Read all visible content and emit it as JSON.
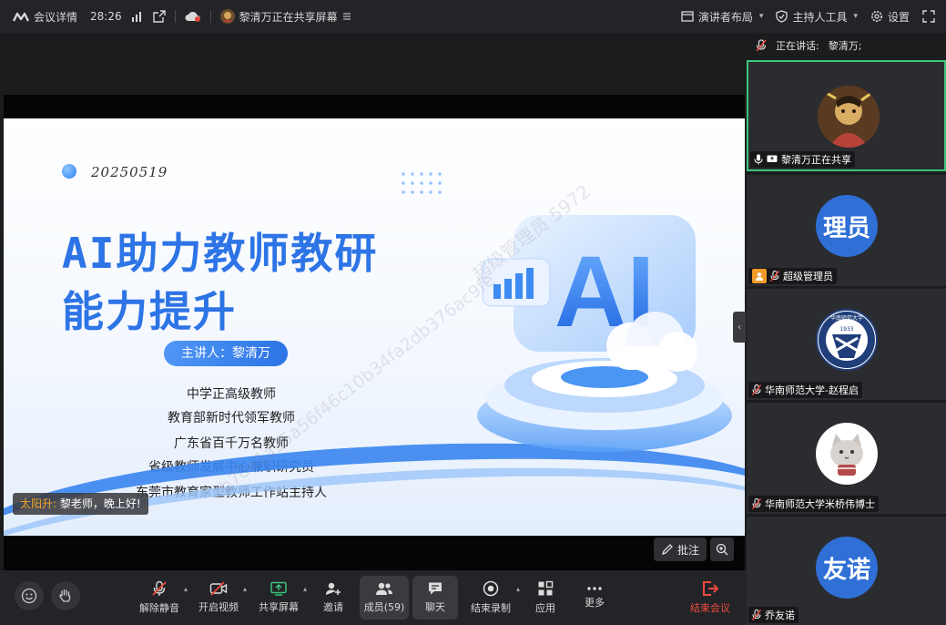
{
  "topbar": {
    "meeting_info": "会议详情",
    "duration": "28:26",
    "sharing_status": "黎清万正在共享屏幕",
    "layout_label": "演讲者布局",
    "host_tools_label": "主持人工具",
    "settings_label": "设置"
  },
  "slide": {
    "date": "20250519",
    "title_line1": "AI助力教师教研",
    "title_line2": "能力提升",
    "presenter": "主讲人：黎清万",
    "credentials": [
      "中学正高级教师",
      "教育部新时代领军教师",
      "广东省百千万名教师",
      "省级教师发展中心兼职研究员",
      "东莞市教育家型教师工作站主持人"
    ],
    "art_text": "AI",
    "watermark_1": "超级管理员 5972",
    "watermark_2": "b70e1a95a56f46c10b34fa2db376ac9fe",
    "watermark_3": "2db376ac9fe",
    "watermark_4": "b70e1a95a56f4",
    "watermark_5": "5972"
  },
  "chat_toast": {
    "sender": "太阳升:",
    "message": "黎老师，晚上好!"
  },
  "stage_controls": {
    "annotate_label": "批注"
  },
  "toolbar": {
    "unmute": "解除静音",
    "start_video": "开启视频",
    "share_screen": "共享屏幕",
    "invite": "邀请",
    "members": "成员(59)",
    "chat": "聊天",
    "end_recording": "结束录制",
    "apps": "应用",
    "more": "更多",
    "end_meeting": "结束会议"
  },
  "panel": {
    "speaking_label": "正在讲话:",
    "speaking_name": "黎清万;",
    "participants": [
      {
        "name": "黎清万正在共享",
        "type": "photo"
      },
      {
        "name": "超级管理员",
        "type": "text",
        "avatar_text": "理员"
      },
      {
        "name": "华南师范大学-赵程启",
        "type": "logo",
        "logo_text": "华南师范大学",
        "logo_year": "1933"
      },
      {
        "name": "华南师范大学米桥伟博士",
        "type": "cat"
      },
      {
        "name": "乔友诺",
        "type": "text",
        "avatar_text": "友诺"
      }
    ]
  },
  "colors": {
    "accent_blue": "#2d74e6",
    "active_speaker_border": "#3cc47c",
    "end_red": "#f04a3e",
    "chat_name": "#f5a623"
  }
}
